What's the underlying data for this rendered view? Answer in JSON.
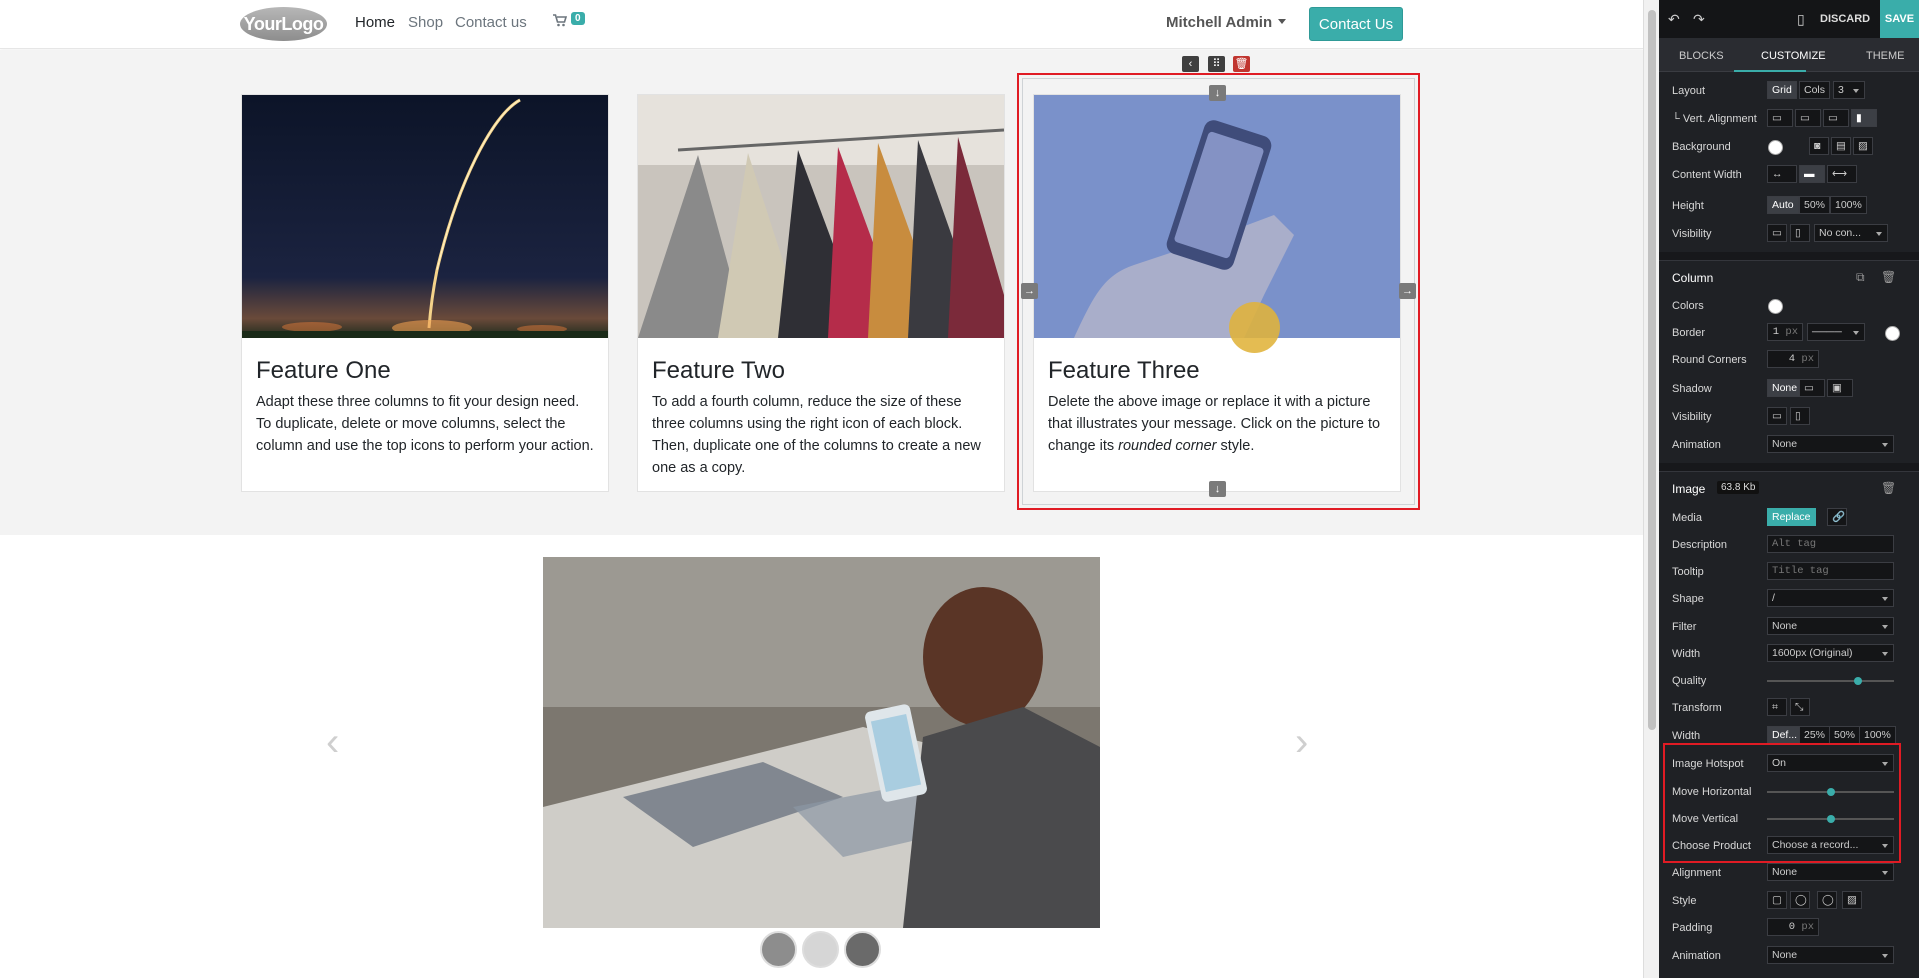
{
  "header": {
    "logo_text": "YourLogo",
    "nav": [
      "Home",
      "Shop",
      "Contact us"
    ],
    "cart_icon": "cart-icon",
    "cart_count": "0",
    "user": "Mitchell Admin",
    "contact_button": "Contact Us"
  },
  "features": [
    {
      "title": "Feature One",
      "text": "Adapt these three columns to fit your design need. To duplicate, delete or move columns, select the column and use the top icons to perform your action."
    },
    {
      "title": "Feature Two",
      "text": "To add a fourth column, reduce the size of these three columns using the right icon of each block. Then, duplicate one of the columns to create a new one as a copy."
    },
    {
      "title": "Feature Three",
      "text_before": "Delete the above image or replace it with a picture that illustrates your message. Click on the picture to change its ",
      "text_em": "rounded corner",
      "text_after": " style."
    }
  ],
  "editor": {
    "top": {
      "undo_icon": "undo-icon",
      "redo_icon": "redo-icon",
      "mobile_icon": "mobile-icon",
      "discard": "DISCARD",
      "save": "SAVE"
    },
    "tabs": [
      "BLOCKS",
      "CUSTOMIZE",
      "THEME"
    ],
    "active_tab": "CUSTOMIZE",
    "block": {
      "layout_label": "Layout",
      "layout_grid": "Grid",
      "layout_cols": "Cols",
      "layout_cols_value": "3",
      "vert_alignment_label": "└ Vert. Alignment",
      "background_label": "Background",
      "content_width_label": "Content Width",
      "height_label": "Height",
      "height_options": [
        "Auto",
        "50%",
        "100%"
      ],
      "visibility_label": "Visibility",
      "visibility_select": "No con..."
    },
    "column": {
      "title": "Column",
      "colors_label": "Colors",
      "border_label": "Border",
      "border_width": "1",
      "border_unit": "px",
      "round_corners_label": "Round Corners",
      "round_corners_value": "4",
      "round_corners_unit": "px",
      "shadow_label": "Shadow",
      "shadow_value": "None",
      "visibility_label": "Visibility",
      "animation_label": "Animation",
      "animation_value": "None"
    },
    "image": {
      "title": "Image",
      "size_badge": "63.8 Kb",
      "media_label": "Media",
      "replace_button": "Replace",
      "description_label": "Description",
      "description_placeholder": "Alt tag",
      "tooltip_label": "Tooltip",
      "tooltip_placeholder": "Title tag",
      "shape_label": "Shape",
      "shape_value": "/",
      "filter_label": "Filter",
      "filter_value": "None",
      "width_label": "Width",
      "width_value": "1600px (Original)",
      "quality_label": "Quality",
      "quality_level": 0.72,
      "transform_label": "Transform",
      "width2_label": "Width",
      "width2_options": [
        "Def...",
        "25%",
        "50%",
        "100%"
      ],
      "hotspot_label": "Image Hotspot",
      "hotspot_value": "On",
      "move_h_label": "Move Horizontal",
      "move_h_level": 0.5,
      "move_v_label": "Move Vertical",
      "move_v_level": 0.5,
      "product_label": "Choose Product",
      "product_value": "Choose a record...",
      "alignment_label": "Alignment",
      "alignment_value": "None",
      "style_label": "Style",
      "padding_label": "Padding",
      "padding_value": "0",
      "padding_unit": "px",
      "animation_label": "Animation",
      "animation_value": "None"
    }
  },
  "colors": {
    "accent": "#3aadaa",
    "highlight": "#e01b24",
    "hotspot": "#e0b33a",
    "panel": "#1f2125"
  }
}
